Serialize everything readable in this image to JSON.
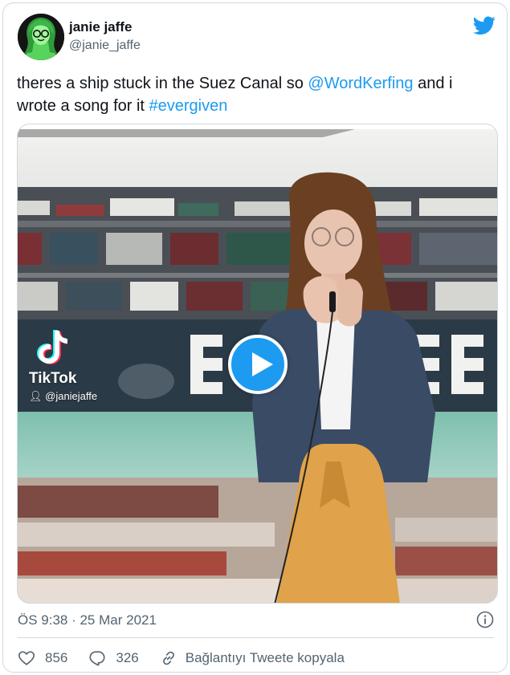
{
  "author": {
    "display_name": "janie jaffe",
    "handle": "@janie_jaffe"
  },
  "tweet": {
    "text_parts": [
      "theres a ship stuck in the Suez Canal so ",
      "@WordKerfing",
      " and i",
      "wrote a song for it ",
      "#evergiven"
    ]
  },
  "media": {
    "tiktok_brand": "TikTok",
    "tiktok_user": "@janiejaffe",
    "ship_lettering": "EVERGREEN"
  },
  "meta": {
    "timestamp": "ÖS 9:38 · 25 Mar 2021"
  },
  "actions": {
    "like_count": "856",
    "reply_count": "326",
    "copy_label": "Bağlantıyı Tweete kopyala"
  },
  "icons": {
    "brand": "twitter-bird-icon",
    "like": "heart-icon",
    "reply": "reply-bubble-icon",
    "copy": "link-icon",
    "info": "info-icon",
    "play": "play-icon"
  },
  "colors": {
    "link": "#1d9bf0",
    "play_button": "#1d9bf0",
    "muted_text": "#536471",
    "border": "#cfd9de",
    "skirt": "#e0a24a",
    "jacket": "#3a4b66",
    "sea": "#8fc9bb"
  }
}
